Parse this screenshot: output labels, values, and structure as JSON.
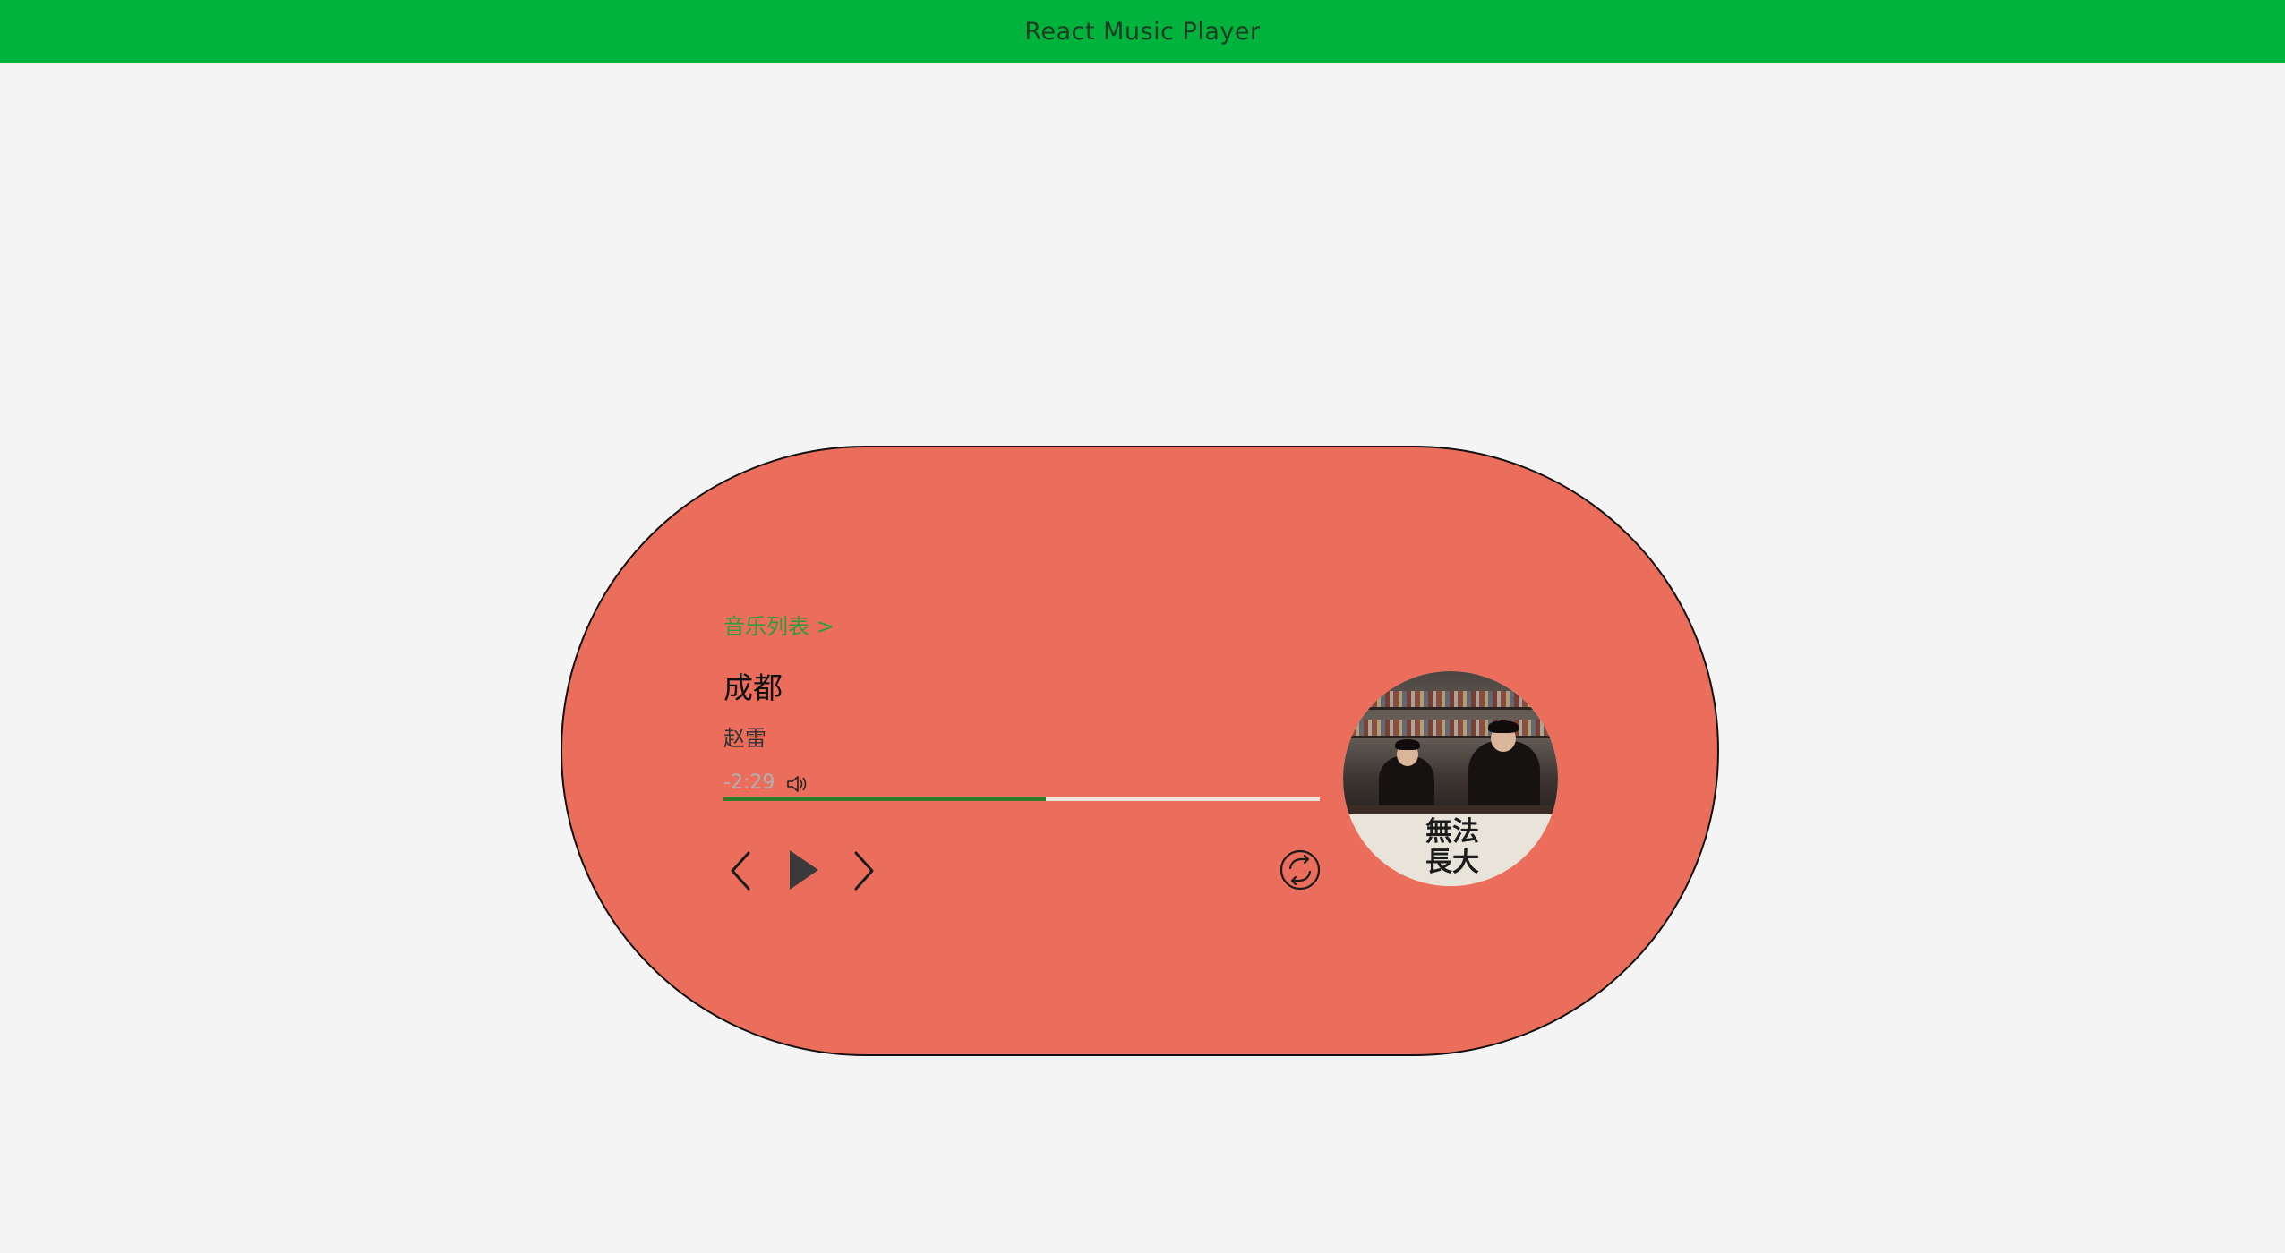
{
  "header": {
    "title": "React Music Player"
  },
  "player": {
    "list_link": "音乐列表 >",
    "song_title": "成都",
    "artist": "赵雷",
    "time_left": "-2:29",
    "progress": 0.54,
    "controls": {
      "prev": "prev-icon",
      "play": "play-icon",
      "next": "next-icon",
      "repeat": "repeat-icon",
      "volume": "volume-icon"
    },
    "cover_text": "無法長大"
  },
  "colors": {
    "header_bg": "#00b33c",
    "player_bg": "#ea6e5b",
    "progress_fill": "#2f7d2c",
    "link": "#2e9c3a"
  }
}
